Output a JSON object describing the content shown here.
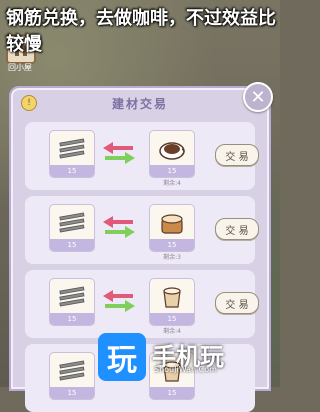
{
  "caption": "钢筋兑换，去做咖啡，不过效益比较慢",
  "top_left": {
    "label": "回小屋"
  },
  "panel": {
    "title": "建材交易",
    "info_icon": "info-icon",
    "close_icon": "close-icon"
  },
  "rows": [
    {
      "give_qty": "15",
      "get_qty": "15",
      "remain": "剩余:4",
      "button": "交 易",
      "get_item": "coffee-cup"
    },
    {
      "give_qty": "15",
      "get_qty": "15",
      "remain": "剩余:3",
      "button": "交 易",
      "get_item": "cake"
    },
    {
      "give_qty": "15",
      "get_qty": "15",
      "remain": "剩余:4",
      "button": "交 易",
      "get_item": "latte"
    },
    {
      "give_qty": "15",
      "get_qty": "15",
      "remain": "",
      "button": "",
      "get_item": "latte"
    }
  ],
  "watermark": {
    "logo_char": "玩",
    "text": "手机玩",
    "sub": "ShouJiWan.Com"
  },
  "colors": {
    "panel_bg": "#d8d1e6",
    "row_bg": "#eee9f6",
    "arrow_green": "#7fcf5a",
    "arrow_red": "#e05a7a"
  }
}
